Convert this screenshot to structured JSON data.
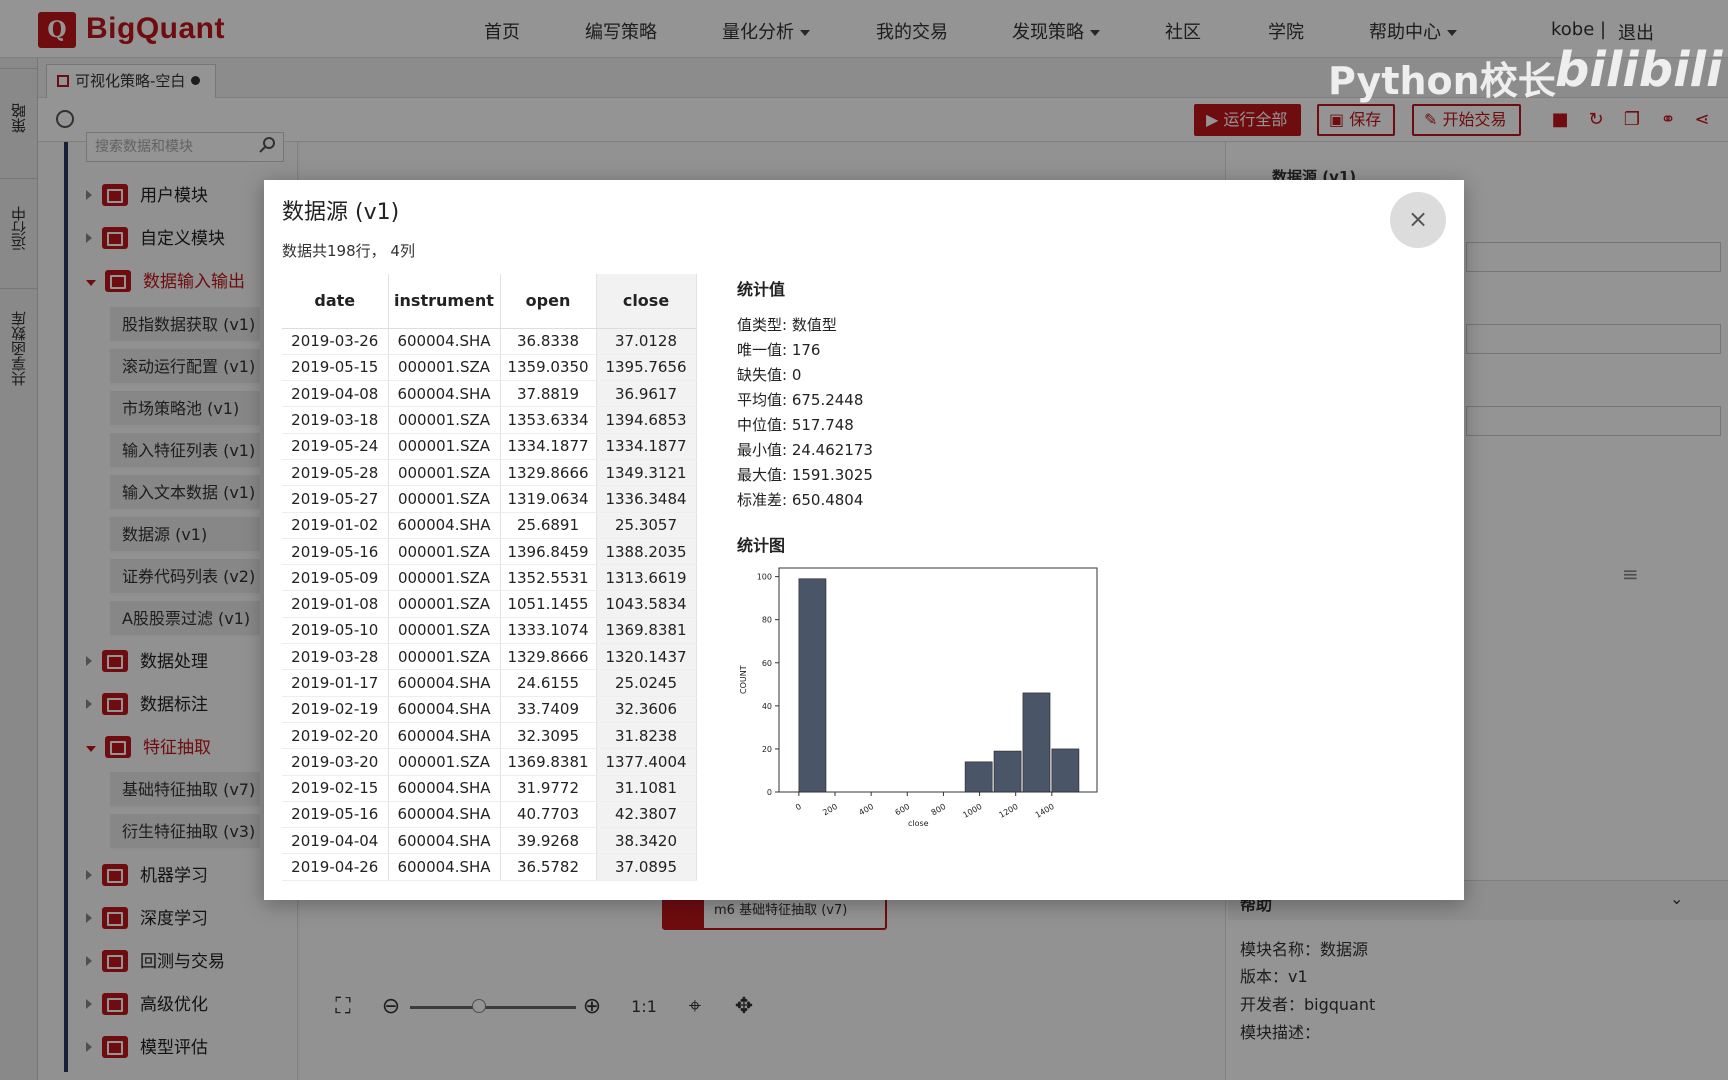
{
  "brand": {
    "logo_letter": "Q",
    "name": "BigQuant"
  },
  "nav": {
    "items": [
      {
        "label": "首页",
        "dropdown": false
      },
      {
        "label": "编写策略",
        "dropdown": false
      },
      {
        "label": "量化分析",
        "dropdown": true
      },
      {
        "label": "我的交易",
        "dropdown": false
      },
      {
        "label": "发现策略",
        "dropdown": true
      },
      {
        "label": "社区",
        "dropdown": false
      },
      {
        "label": "学院",
        "dropdown": false
      },
      {
        "label": "帮助中心",
        "dropdown": true
      }
    ],
    "user": "kobe",
    "separator": "|",
    "logout": "退出"
  },
  "vertical_tabs": [
    "策略",
    "运行中",
    "共享函数库"
  ],
  "editor": {
    "file_tab": "可视化策略-空白"
  },
  "toolbar": {
    "run_all": "运行全部",
    "save": "保存",
    "start_trade": "开始交易"
  },
  "sidebar": {
    "search_placeholder": "搜索数据和模块",
    "categories": [
      {
        "label": "用户模块",
        "open": false
      },
      {
        "label": "自定义模块",
        "open": false
      },
      {
        "label": "数据输入输出",
        "open": true,
        "children": [
          "股指数据获取 (v1)",
          "滚动运行配置 (v1)",
          "市场策略池 (v1)",
          "输入特征列表 (v1)",
          "输入文本数据 (v1)",
          "数据源 (v1)",
          "证券代码列表 (v2)",
          "A股股票过滤 (v1)"
        ]
      },
      {
        "label": "数据处理",
        "open": false
      },
      {
        "label": "数据标注",
        "open": false
      },
      {
        "label": "特征抽取",
        "open": true,
        "children": [
          "基础特征抽取 (v7)",
          "衍生特征抽取 (v3)"
        ]
      },
      {
        "label": "机器学习",
        "open": false
      },
      {
        "label": "深度学习",
        "open": false
      },
      {
        "label": "回测与交易",
        "open": false
      },
      {
        "label": "高级优化",
        "open": false
      },
      {
        "label": "模型评估",
        "open": false
      }
    ]
  },
  "canvas": {
    "node_label": "m6 基础特征抽取 (v7)"
  },
  "right_panel": {
    "title": "数据源 (v1)",
    "help_title": "帮助",
    "help": {
      "module_name": "模块名称：数据源",
      "version": "版本：v1",
      "developer": "开发者：bigquant",
      "description": "模块描述："
    }
  },
  "modal": {
    "title": "数据源 (v1)",
    "close_icon": "×",
    "summary": "数据共198行， 4列",
    "table": {
      "columns": [
        "date",
        "instrument",
        "open",
        "close"
      ],
      "rows": [
        [
          "2019-03-26",
          "600004.SHA",
          "36.8338",
          "37.0128"
        ],
        [
          "2019-05-15",
          "000001.SZA",
          "1359.0350",
          "1395.7656"
        ],
        [
          "2019-04-08",
          "600004.SHA",
          "37.8819",
          "36.9617"
        ],
        [
          "2019-03-18",
          "000001.SZA",
          "1353.6334",
          "1394.6853"
        ],
        [
          "2019-05-24",
          "000001.SZA",
          "1334.1877",
          "1334.1877"
        ],
        [
          "2019-05-28",
          "000001.SZA",
          "1329.8666",
          "1349.3121"
        ],
        [
          "2019-05-27",
          "000001.SZA",
          "1319.0634",
          "1336.3484"
        ],
        [
          "2019-01-02",
          "600004.SHA",
          "25.6891",
          "25.3057"
        ],
        [
          "2019-05-16",
          "000001.SZA",
          "1396.8459",
          "1388.2035"
        ],
        [
          "2019-05-09",
          "000001.SZA",
          "1352.5531",
          "1313.6619"
        ],
        [
          "2019-01-08",
          "000001.SZA",
          "1051.1455",
          "1043.5834"
        ],
        [
          "2019-05-10",
          "000001.SZA",
          "1333.1074",
          "1369.8381"
        ],
        [
          "2019-03-28",
          "000001.SZA",
          "1329.8666",
          "1320.1437"
        ],
        [
          "2019-01-17",
          "600004.SHA",
          "24.6155",
          "25.0245"
        ],
        [
          "2019-02-19",
          "600004.SHA",
          "33.7409",
          "32.3606"
        ],
        [
          "2019-02-20",
          "600004.SHA",
          "32.3095",
          "31.8238"
        ],
        [
          "2019-03-20",
          "000001.SZA",
          "1369.8381",
          "1377.4004"
        ],
        [
          "2019-02-15",
          "600004.SHA",
          "31.9772",
          "31.1081"
        ],
        [
          "2019-05-16",
          "600004.SHA",
          "40.7703",
          "42.3807"
        ],
        [
          "2019-04-04",
          "600004.SHA",
          "39.9268",
          "38.3420"
        ],
        [
          "2019-04-26",
          "600004.SHA",
          "36.5782",
          "37.0895"
        ]
      ]
    },
    "stats_title": "统计值",
    "stats": [
      "值类型: 数值型",
      "唯一值: 176",
      "缺失值:  0",
      "平均值:  675.2448",
      "中位值:  517.748",
      "最小值:  24.462173",
      "最大值:  1591.3025",
      "标准差:  650.4804"
    ],
    "chart_title": "统计图"
  },
  "chart_data": {
    "type": "bar",
    "xlabel": "close",
    "ylabel": "COUNT",
    "xlim": [
      -110,
      1650
    ],
    "ylim": [
      0,
      104
    ],
    "xticks": [
      0,
      200,
      400,
      600,
      800,
      1000,
      1200,
      1400
    ],
    "yticks": [
      0,
      20,
      40,
      60,
      80,
      100
    ],
    "bins": [
      {
        "x0": 0,
        "x1": 150,
        "count": 99
      },
      {
        "x0": 920,
        "x1": 1070,
        "count": 14
      },
      {
        "x0": 1080,
        "x1": 1230,
        "count": 19
      },
      {
        "x0": 1240,
        "x1": 1390,
        "count": 46
      },
      {
        "x0": 1400,
        "x1": 1550,
        "count": 20
      }
    ],
    "bar_color": "#4a5568"
  },
  "watermark": {
    "text": "Python校长",
    "site": "bilibili"
  }
}
